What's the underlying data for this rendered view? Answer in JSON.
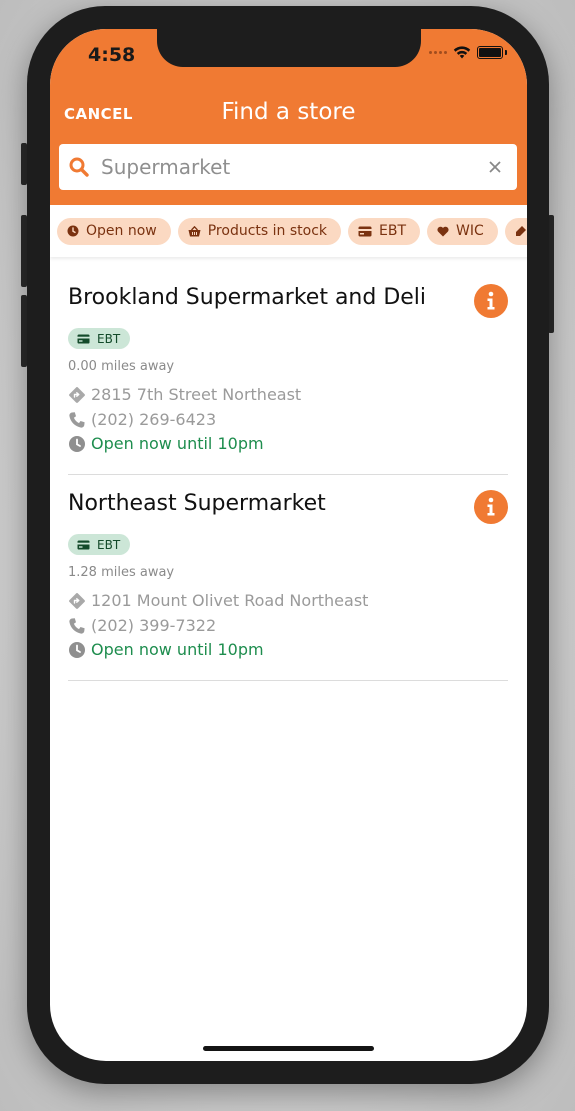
{
  "status_bar": {
    "time": "4:58"
  },
  "header": {
    "cancel_label": "CANCEL",
    "title": "Find a store",
    "accent_color": "#f07a33"
  },
  "search": {
    "value": "Supermarket",
    "icon": "search-icon",
    "clear_icon": "close-icon"
  },
  "filters": [
    {
      "label": "Open now",
      "icon": "clock-icon"
    },
    {
      "label": "Products in stock",
      "icon": "basket-icon"
    },
    {
      "label": "EBT",
      "icon": "credit-card-icon"
    },
    {
      "label": "WIC",
      "icon": "heart-icon"
    },
    {
      "label": "",
      "icon": "tag-icon"
    }
  ],
  "stores": [
    {
      "name": "Brookland Supermarket and Deli",
      "badge": "EBT",
      "distance": "0.00 miles away",
      "address": "2815 7th Street Northeast",
      "phone": "(202) 269-6423",
      "hours": "Open now until 10pm"
    },
    {
      "name": "Northeast Supermarket",
      "badge": "EBT",
      "distance": "1.28 miles away",
      "address": "1201 Mount Olivet Road Northeast",
      "phone": "(202) 399-7322",
      "hours": "Open now until 10pm"
    }
  ]
}
